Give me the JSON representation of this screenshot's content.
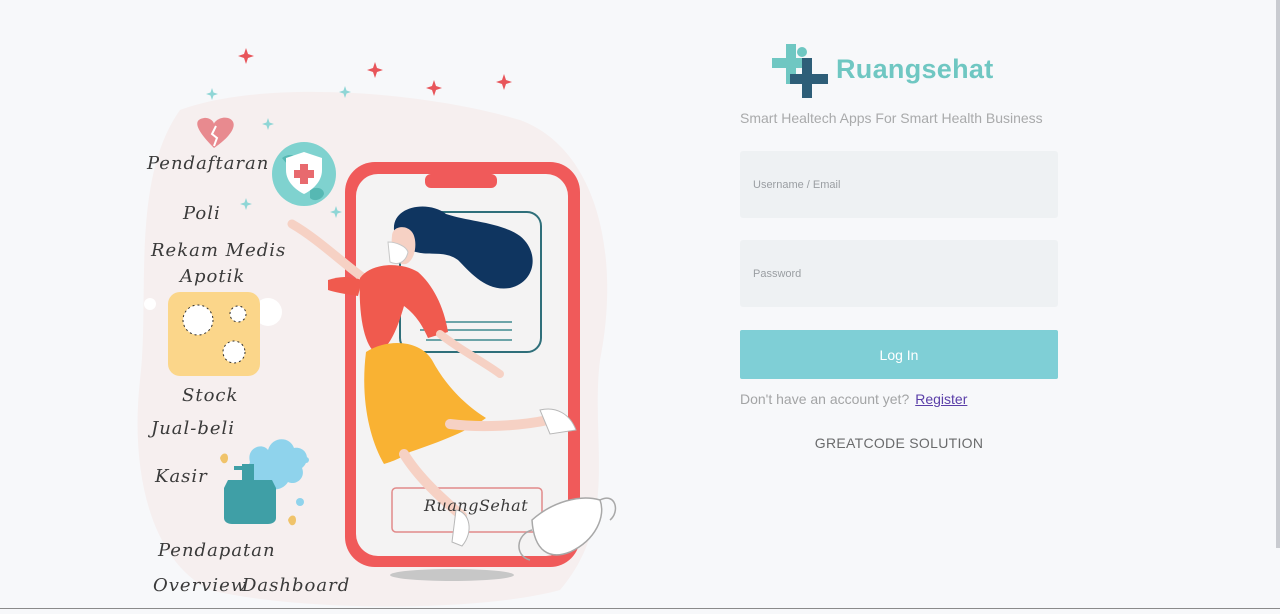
{
  "illustration": {
    "menu": [
      "Pendaftaran",
      "Poli",
      "Rekam Medis",
      "Apotik",
      "Stock",
      "Jual-beli",
      "Kasir",
      "Pendapatan",
      "Overview",
      "Dashboard"
    ],
    "phone_brand": "RuangSehat"
  },
  "brand": {
    "name": "Ruangsehat",
    "tagline": "Smart Healtech Apps For Smart Health Business",
    "logo_icon": "medical-cross-icon"
  },
  "form": {
    "username_placeholder": "Username / Email",
    "password_placeholder": "Password",
    "login_label": "Log In",
    "no_account_text": "Don't have an account yet?",
    "register_label": "Register"
  },
  "footer": {
    "company": "GREATCODE SOLUTION"
  },
  "colors": {
    "accent": "#7fcfd6",
    "brand_teal": "#6fc7c2",
    "brand_navy": "#2e5e78",
    "phone_red": "#f05a5a",
    "link": "#5a3ea8"
  }
}
